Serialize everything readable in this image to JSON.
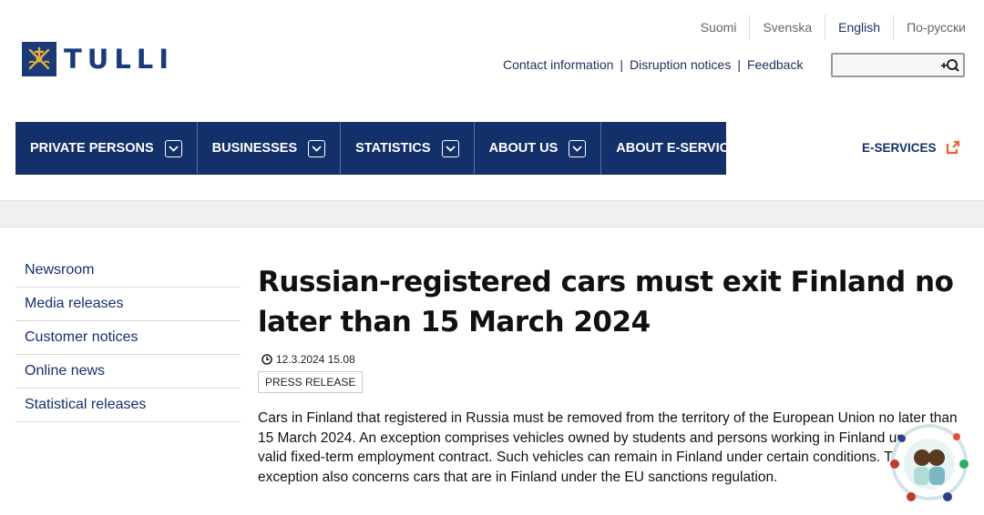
{
  "languages": [
    {
      "label": "Suomi",
      "active": false
    },
    {
      "label": "Svenska",
      "active": false
    },
    {
      "label": "English",
      "active": true
    },
    {
      "label": "По-русски",
      "active": false
    }
  ],
  "logo": {
    "text": "TULLI"
  },
  "utility_links": [
    "Contact information",
    "Disruption notices",
    "Feedback"
  ],
  "search": {
    "placeholder": ""
  },
  "main_nav": [
    "PRIVATE PERSONS",
    "BUSINESSES",
    "STATISTICS",
    "ABOUT US",
    "ABOUT E-SERVICES"
  ],
  "eservices": {
    "label": "E-SERVICES"
  },
  "sidebar": [
    "Newsroom",
    "Media releases",
    "Customer notices",
    "Online news",
    "Statistical releases"
  ],
  "article": {
    "title": "Russian-registered cars must exit Finland no later than 15 March 2024",
    "date": "12.3.2024 15.08",
    "tag": "PRESS RELEASE",
    "body": "Cars in Finland that registered in Russia must be removed from the territory of the European Union no later than 15 March 2024. An exception comprises vehicles owned by students and persons working in Finland under a valid fixed-term employment contract. Such vehicles can remain in Finland under certain conditions. This exception also concerns cars that are in Finland under the EU sanctions regulation."
  },
  "colors": {
    "brand": "#14306a",
    "accent": "#e8662a",
    "band": "#f0f0f0"
  },
  "icons": [
    "tulli-logo-icon",
    "search-icon",
    "chevron-down-icon",
    "external-link-icon",
    "clock-icon"
  ]
}
